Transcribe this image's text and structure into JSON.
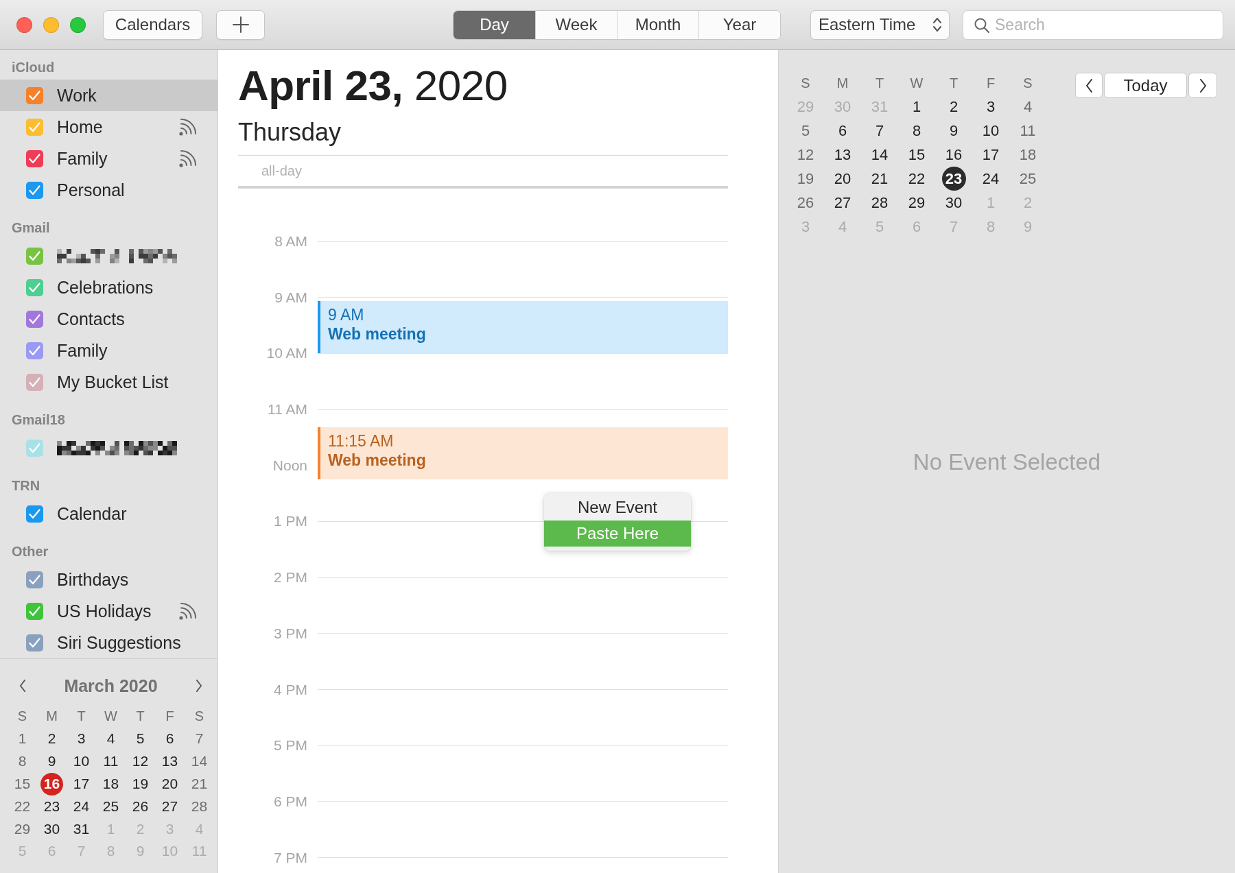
{
  "toolbar": {
    "calendars_button": "Calendars",
    "views": [
      {
        "label": "Day",
        "selected": true
      },
      {
        "label": "Week",
        "selected": false
      },
      {
        "label": "Month",
        "selected": false
      },
      {
        "label": "Year",
        "selected": false
      }
    ],
    "timezone": "Eastern Time",
    "search": {
      "placeholder": "Search"
    }
  },
  "sidebar": {
    "groups": [
      {
        "title": "iCloud",
        "calendars": [
          {
            "kind": "calendar",
            "name": "Work",
            "checked": true,
            "selected": true,
            "shared": false,
            "color": "#f5822a"
          },
          {
            "kind": "calendar",
            "name": "Home",
            "checked": true,
            "selected": false,
            "shared": true,
            "color": "#fdbd30"
          },
          {
            "kind": "calendar",
            "name": "Family",
            "checked": true,
            "selected": false,
            "shared": true,
            "color": "#ef3c57"
          },
          {
            "kind": "calendar",
            "name": "Personal",
            "checked": true,
            "selected": false,
            "shared": false,
            "color": "#1b98f0"
          }
        ]
      },
      {
        "title": "Gmail",
        "calendars": [
          {
            "kind": "redacted",
            "checked": true,
            "selected": false,
            "shared": false,
            "color": "#78c442"
          },
          {
            "kind": "calendar",
            "name": "Celebrations",
            "checked": true,
            "selected": false,
            "shared": false,
            "color": "#4ccf90"
          },
          {
            "kind": "calendar",
            "name": "Contacts",
            "checked": true,
            "selected": false,
            "shared": false,
            "color": "#a277dd"
          },
          {
            "kind": "calendar",
            "name": "Family",
            "checked": true,
            "selected": false,
            "shared": false,
            "color": "#9a9af4"
          },
          {
            "kind": "calendar",
            "name": "My Bucket List",
            "checked": true,
            "selected": false,
            "shared": false,
            "color": "#d6b0b7"
          }
        ]
      },
      {
        "title": "Gmail18",
        "calendars": [
          {
            "kind": "redacted",
            "checked": true,
            "selected": false,
            "shared": false,
            "color": "#a8e1e7"
          }
        ]
      },
      {
        "title": "TRN",
        "calendars": [
          {
            "kind": "calendar",
            "name": "Calendar",
            "checked": true,
            "selected": false,
            "shared": false,
            "color": "#1b98f0"
          }
        ]
      },
      {
        "title": "Other",
        "calendars": [
          {
            "kind": "calendar",
            "name": "Birthdays",
            "checked": true,
            "selected": false,
            "shared": false,
            "color": "#8aa0bf"
          },
          {
            "kind": "calendar",
            "name": "US Holidays",
            "checked": true,
            "selected": false,
            "shared": true,
            "color": "#3fc43b"
          },
          {
            "kind": "calendar",
            "name": "Siri Suggestions",
            "checked": true,
            "selected": false,
            "shared": false,
            "color": "#8aa0bf"
          }
        ]
      }
    ],
    "mini_calendar": {
      "title": "March 2020",
      "weekdays": [
        "S",
        "M",
        "T",
        "W",
        "T",
        "F",
        "S"
      ],
      "days": [
        {
          "day": "1",
          "in_month": true,
          "today": false,
          "selected": false
        },
        {
          "day": "2",
          "in_month": true,
          "today": false,
          "selected": false
        },
        {
          "day": "3",
          "in_month": true,
          "today": false,
          "selected": false
        },
        {
          "day": "4",
          "in_month": true,
          "today": false,
          "selected": false
        },
        {
          "day": "5",
          "in_month": true,
          "today": false,
          "selected": false
        },
        {
          "day": "6",
          "in_month": true,
          "today": false,
          "selected": false
        },
        {
          "day": "7",
          "in_month": true,
          "today": false,
          "selected": false
        },
        {
          "day": "8",
          "in_month": true,
          "today": false,
          "selected": false
        },
        {
          "day": "9",
          "in_month": true,
          "today": false,
          "selected": false
        },
        {
          "day": "10",
          "in_month": true,
          "today": false,
          "selected": false
        },
        {
          "day": "11",
          "in_month": true,
          "today": false,
          "selected": false
        },
        {
          "day": "12",
          "in_month": true,
          "today": false,
          "selected": false
        },
        {
          "day": "13",
          "in_month": true,
          "today": false,
          "selected": false
        },
        {
          "day": "14",
          "in_month": true,
          "today": false,
          "selected": false
        },
        {
          "day": "15",
          "in_month": true,
          "today": false,
          "selected": false
        },
        {
          "day": "16",
          "in_month": true,
          "today": true,
          "selected": false
        },
        {
          "day": "17",
          "in_month": true,
          "today": false,
          "selected": false
        },
        {
          "day": "18",
          "in_month": true,
          "today": false,
          "selected": false
        },
        {
          "day": "19",
          "in_month": true,
          "today": false,
          "selected": false
        },
        {
          "day": "20",
          "in_month": true,
          "today": false,
          "selected": false
        },
        {
          "day": "21",
          "in_month": true,
          "today": false,
          "selected": false
        },
        {
          "day": "22",
          "in_month": true,
          "today": false,
          "selected": false
        },
        {
          "day": "23",
          "in_month": true,
          "today": false,
          "selected": false
        },
        {
          "day": "24",
          "in_month": true,
          "today": false,
          "selected": false
        },
        {
          "day": "25",
          "in_month": true,
          "today": false,
          "selected": false
        },
        {
          "day": "26",
          "in_month": true,
          "today": false,
          "selected": false
        },
        {
          "day": "27",
          "in_month": true,
          "today": false,
          "selected": false
        },
        {
          "day": "28",
          "in_month": true,
          "today": false,
          "selected": false
        },
        {
          "day": "29",
          "in_month": true,
          "today": false,
          "selected": false
        },
        {
          "day": "30",
          "in_month": true,
          "today": false,
          "selected": false
        },
        {
          "day": "31",
          "in_month": true,
          "today": false,
          "selected": false
        },
        {
          "day": "1",
          "in_month": false,
          "today": false,
          "selected": false
        },
        {
          "day": "2",
          "in_month": false,
          "today": false,
          "selected": false
        },
        {
          "day": "3",
          "in_month": false,
          "today": false,
          "selected": false
        },
        {
          "day": "4",
          "in_month": false,
          "today": false,
          "selected": false
        },
        {
          "day": "5",
          "in_month": false,
          "today": false,
          "selected": false
        },
        {
          "day": "6",
          "in_month": false,
          "today": false,
          "selected": false
        },
        {
          "day": "7",
          "in_month": false,
          "today": false,
          "selected": false
        },
        {
          "day": "8",
          "in_month": false,
          "today": false,
          "selected": false
        },
        {
          "day": "9",
          "in_month": false,
          "today": false,
          "selected": false
        },
        {
          "day": "10",
          "in_month": false,
          "today": false,
          "selected": false
        },
        {
          "day": "11",
          "in_month": false,
          "today": false,
          "selected": false
        }
      ]
    }
  },
  "day_view": {
    "date_title": "**April 23,** 2020",
    "weekday": "Thursday",
    "all_day_label": "all-day",
    "hours": [
      {
        "label": "8 AM"
      },
      {
        "label": "9 AM",
        "events": [
          {
            "time": "9 AM",
            "title": "Web meeting",
            "color": "#1b98f0"
          }
        ]
      },
      {
        "label": "10 AM"
      },
      {
        "label": "11 AM",
        "events": [
          {
            "time": "11:15 AM",
            "title": "Web meeting",
            "color": "#f5822a"
          }
        ]
      },
      {
        "label": "Noon"
      },
      {
        "label": "1 PM"
      },
      {
        "label": "2 PM"
      },
      {
        "label": "3 PM"
      },
      {
        "label": "4 PM"
      },
      {
        "label": "5 PM"
      },
      {
        "label": "6 PM"
      },
      {
        "label": "7 PM"
      }
    ],
    "context_menu": {
      "items": [
        {
          "label": "New Event",
          "selected": false
        },
        {
          "label": "Paste Here",
          "selected": true
        }
      ]
    }
  },
  "inspector": {
    "mini_calendar": {
      "weekdays": [
        "S",
        "M",
        "T",
        "W",
        "T",
        "F",
        "S"
      ],
      "days": [
        {
          "day": "29",
          "in_month": false,
          "selected": false
        },
        {
          "day": "30",
          "in_month": false,
          "selected": false
        },
        {
          "day": "31",
          "in_month": false,
          "selected": false
        },
        {
          "day": "1",
          "in_month": true,
          "selected": false
        },
        {
          "day": "2",
          "in_month": true,
          "selected": false
        },
        {
          "day": "3",
          "in_month": true,
          "selected": false
        },
        {
          "day": "4",
          "in_month": true,
          "selected": false
        },
        {
          "day": "5",
          "in_month": true,
          "selected": false
        },
        {
          "day": "6",
          "in_month": true,
          "selected": false
        },
        {
          "day": "7",
          "in_month": true,
          "selected": false
        },
        {
          "day": "8",
          "in_month": true,
          "selected": false
        },
        {
          "day": "9",
          "in_month": true,
          "selected": false
        },
        {
          "day": "10",
          "in_month": true,
          "selected": false
        },
        {
          "day": "11",
          "in_month": true,
          "selected": false
        },
        {
          "day": "12",
          "in_month": true,
          "selected": false
        },
        {
          "day": "13",
          "in_month": true,
          "selected": false
        },
        {
          "day": "14",
          "in_month": true,
          "selected": false
        },
        {
          "day": "15",
          "in_month": true,
          "selected": false
        },
        {
          "day": "16",
          "in_month": true,
          "selected": false
        },
        {
          "day": "17",
          "in_month": true,
          "selected": false
        },
        {
          "day": "18",
          "in_month": true,
          "selected": false
        },
        {
          "day": "19",
          "in_month": true,
          "selected": false
        },
        {
          "day": "20",
          "in_month": true,
          "selected": false
        },
        {
          "day": "21",
          "in_month": true,
          "selected": false
        },
        {
          "day": "22",
          "in_month": true,
          "selected": false
        },
        {
          "day": "23",
          "in_month": true,
          "selected": true
        },
        {
          "day": "24",
          "in_month": true,
          "selected": false
        },
        {
          "day": "25",
          "in_month": true,
          "selected": false
        },
        {
          "day": "26",
          "in_month": true,
          "selected": false
        },
        {
          "day": "27",
          "in_month": true,
          "selected": false
        },
        {
          "day": "28",
          "in_month": true,
          "selected": false
        },
        {
          "day": "29",
          "in_month": true,
          "selected": false
        },
        {
          "day": "30",
          "in_month": true,
          "selected": false
        },
        {
          "day": "1",
          "in_month": false,
          "selected": false
        },
        {
          "day": "2",
          "in_month": false,
          "selected": false
        },
        {
          "day": "3",
          "in_month": false,
          "selected": false
        },
        {
          "day": "4",
          "in_month": false,
          "selected": false
        },
        {
          "day": "5",
          "in_month": false,
          "selected": false
        },
        {
          "day": "6",
          "in_month": false,
          "selected": false
        },
        {
          "day": "7",
          "in_month": false,
          "selected": false
        },
        {
          "day": "8",
          "in_month": false,
          "selected": false
        },
        {
          "day": "9",
          "in_month": false,
          "selected": false
        }
      ]
    },
    "today_button": "Today",
    "empty_message": "No Event Selected"
  }
}
